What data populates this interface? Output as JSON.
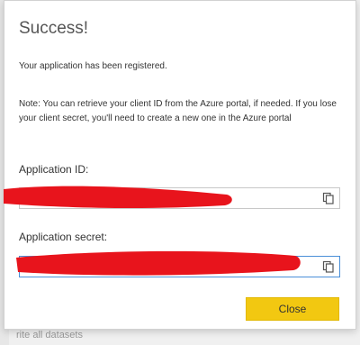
{
  "background": {
    "partial_text": "rite all datasets"
  },
  "dialog": {
    "title": "Success!",
    "message": "Your application has been registered.",
    "note": "Note: You can retrieve your client ID from the Azure portal, if needed. If you lose your client secret, you'll need to create a new one in the Azure portal",
    "application_id": {
      "label": "Application ID:",
      "value": "",
      "copy_icon": "copy-icon"
    },
    "application_secret": {
      "label": "Application secret:",
      "value": "",
      "copy_icon": "copy-icon"
    },
    "close_label": "Close"
  },
  "colors": {
    "accent_button": "#f2c811",
    "redaction": "#e8141c",
    "focus_border": "#4a8fd8"
  }
}
